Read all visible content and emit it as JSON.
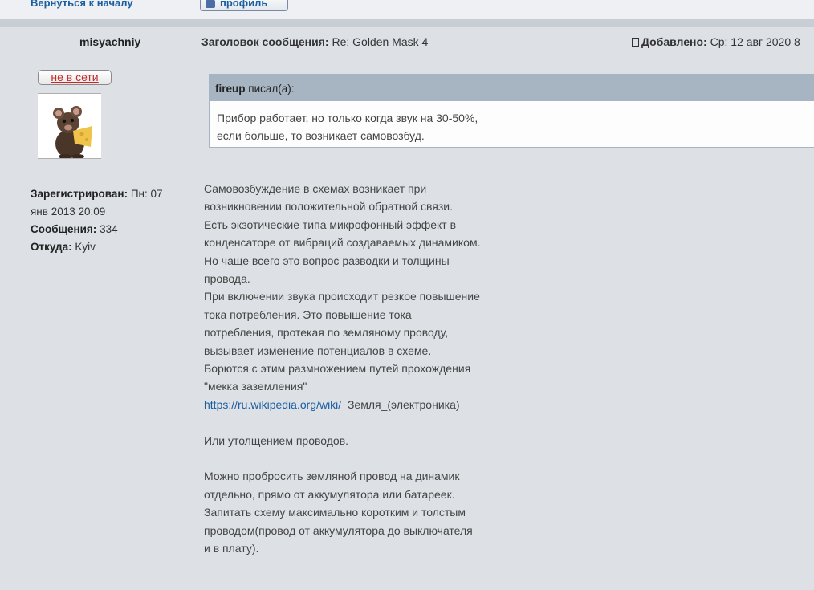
{
  "nav": {
    "back_label": "Вернуться к началу",
    "profile_label": "профиль"
  },
  "post": {
    "author": "misyachniy",
    "subject_label": "Заголовок сообщения:",
    "subject": "Re: Golden Mask 4",
    "posted_label": "Добавлено:",
    "posted": "Ср: 12 авг 2020 8"
  },
  "author_panel": {
    "status": "не в сети",
    "registered_label": "Зарегистрирован:",
    "registered": "Пн: 07 янв 2013 20:09",
    "posts_label": "Сообщения:",
    "posts": "334",
    "location_label": "Откуда:",
    "location": "Kyiv"
  },
  "quote": {
    "author": "fireup",
    "wrote": "писал(а):",
    "lines": [
      "Прибор работает, но только когда звук на 30-50%,",
      "если больше,  то возникает самовозбуд."
    ]
  },
  "body": {
    "para1": [
      "Самовозбуждение в схемах возникает при",
      "возникновении положительной обратной связи.",
      "Есть экзотические  типа микрофонный эффект  в",
      "конденсаторе от вибраций создаваемых динамиком.",
      "Но чаще всего это вопрос разводки и толщины",
      "провода.",
      "При включении звука происходит резкое повышение",
      "тока потребления.  Это повышение тока",
      "потребления, протекая по земляному проводу,",
      "вызывает изменение потенциалов  в схеме.",
      "Борются с этим размножением путей прохождения",
      "\"мекка заземления\""
    ],
    "link": "https://ru.wikipedia.org/wiki/",
    "link_suffix": "  Земля_(электроника)",
    "para2": "Или утолщением  проводов.",
    "para3": [
      "Можно пробросить  земляной провод на динамик",
      "отдельно, прямо от аккумулятора или  батареек.",
      "Запитать схему максимально коротким и толстым",
      "проводом(провод  от аккумулятора до  выключателя",
      "и в плату)."
    ]
  }
}
